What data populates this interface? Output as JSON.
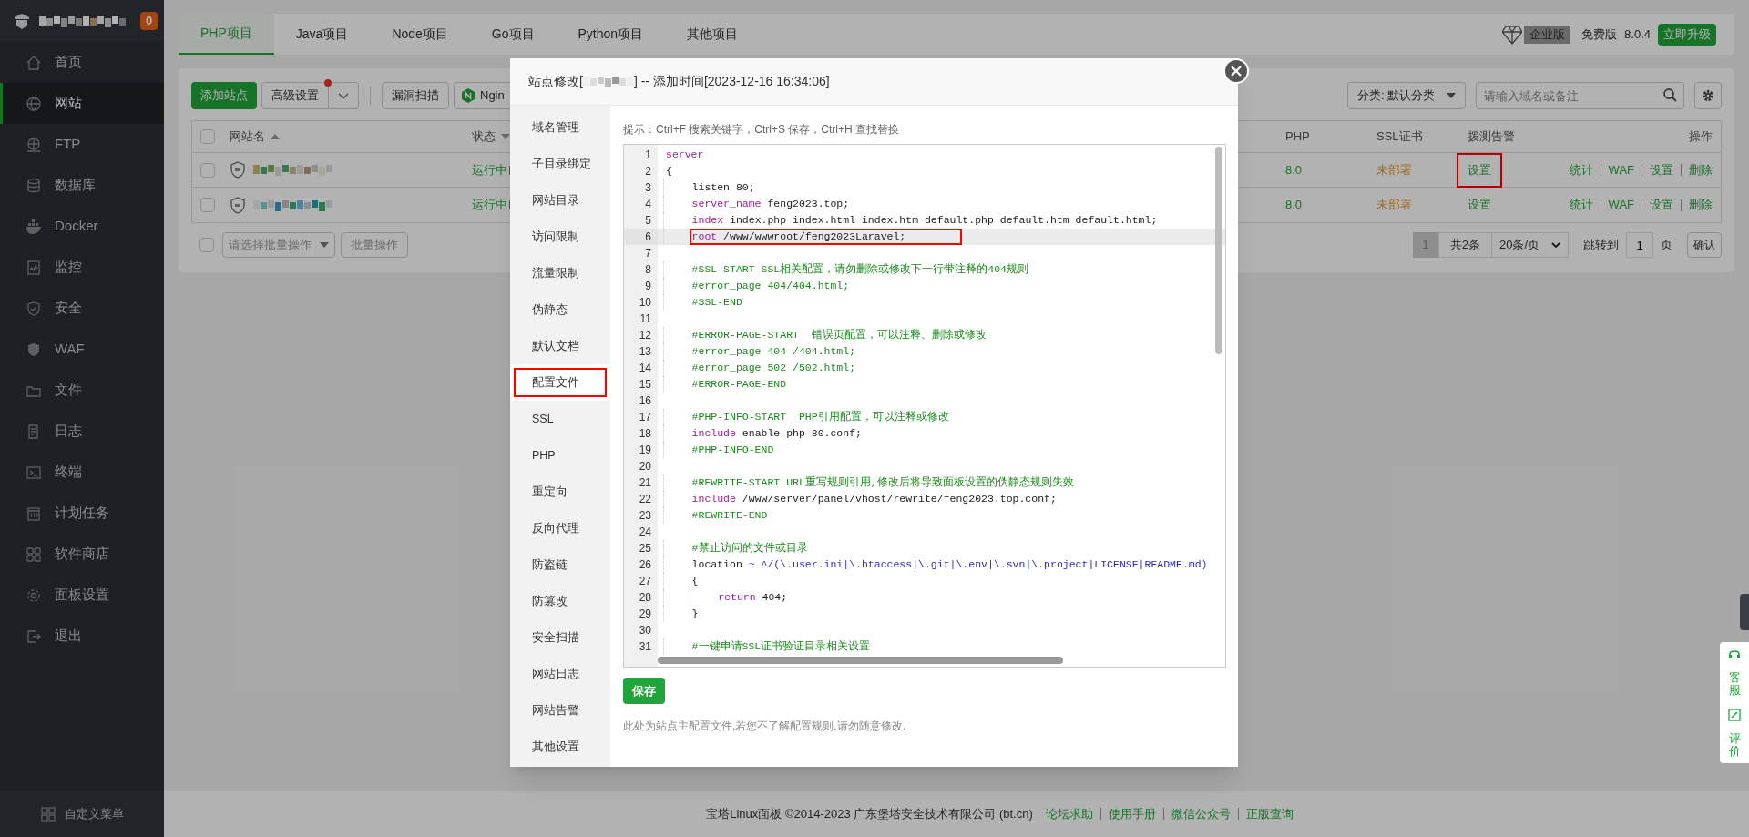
{
  "sidebar": {
    "badge": "0",
    "items": [
      {
        "label": "首页",
        "selected": false
      },
      {
        "label": "网站",
        "selected": true
      },
      {
        "label": "FTP",
        "selected": false
      },
      {
        "label": "数据库",
        "selected": false
      },
      {
        "label": "Docker",
        "selected": false
      },
      {
        "label": "监控",
        "selected": false
      },
      {
        "label": "安全",
        "selected": false
      },
      {
        "label": "WAF",
        "selected": false
      },
      {
        "label": "文件",
        "selected": false
      },
      {
        "label": "日志",
        "selected": false
      },
      {
        "label": "终端",
        "selected": false
      },
      {
        "label": "计划任务",
        "selected": false
      },
      {
        "label": "软件商店",
        "selected": false
      },
      {
        "label": "面板设置",
        "selected": false
      },
      {
        "label": "退出",
        "selected": false
      }
    ],
    "footer": "自定义菜单"
  },
  "top_tabs": [
    {
      "label": "PHP项目",
      "selected": true
    },
    {
      "label": "Java项目",
      "selected": false
    },
    {
      "label": "Node项目",
      "selected": false
    },
    {
      "label": "Go项目",
      "selected": false
    },
    {
      "label": "Python项目",
      "selected": false
    },
    {
      "label": "其他项目",
      "selected": false
    }
  ],
  "edition": {
    "badge": "企业版",
    "plan": "免费版",
    "version": "8.0.4",
    "upgrade": "立即升级"
  },
  "toolbar": {
    "add": "添加站点",
    "advanced": "高级设置",
    "advanced_dot": true,
    "scan": "漏洞扫描",
    "nginx": "Ngin",
    "category": "分类: 默认分类",
    "search_placeholder": "请输入域名或备注"
  },
  "table": {
    "all_checked": false,
    "columns": [
      "网站名",
      "状态",
      "PHP",
      "SSL证书",
      "拨测告警",
      "操作"
    ],
    "rows": [
      {
        "checked": false,
        "status": "运行中",
        "php": "8.0",
        "ssl": "未部署",
        "alert": "设置",
        "alert_annotated": true,
        "actions": [
          "统计",
          "WAF",
          "设置",
          "删除"
        ]
      },
      {
        "checked": false,
        "status": "运行中",
        "php": "8.0",
        "ssl": "未部署",
        "alert": "设置",
        "alert_annotated": false,
        "actions": [
          "统计",
          "WAF",
          "设置",
          "删除"
        ]
      }
    ]
  },
  "batch": {
    "checked": false,
    "placeholder": "请选择批量操作",
    "button": "批量操作"
  },
  "pagination": {
    "current": "1",
    "total": "共2条",
    "per_page": "20条/页",
    "goto": "跳转到",
    "page_input": "1",
    "page_unit": "页",
    "confirm": "确认"
  },
  "footer": {
    "copyright": "宝塔Linux面板 ©2014-2023 广东堡塔安全技术有限公司 (bt.cn)",
    "links": [
      "论坛求助",
      "使用手册",
      "微信公众号",
      "正版查询"
    ]
  },
  "side_widget": [
    "客服",
    "评价"
  ],
  "modal": {
    "title_prefix": "站点修改[",
    "title_suffix": "] -- 添加时间[2023-12-16 16:34:06]",
    "nav": [
      {
        "label": "域名管理",
        "selected": false,
        "annotated": false
      },
      {
        "label": "子目录绑定",
        "selected": false,
        "annotated": false
      },
      {
        "label": "网站目录",
        "selected": false,
        "annotated": false
      },
      {
        "label": "访问限制",
        "selected": false,
        "annotated": false
      },
      {
        "label": "流量限制",
        "selected": false,
        "annotated": false
      },
      {
        "label": "伪静态",
        "selected": false,
        "annotated": false
      },
      {
        "label": "默认文档",
        "selected": false,
        "annotated": false
      },
      {
        "label": "配置文件",
        "selected": true,
        "annotated": true
      },
      {
        "label": "SSL",
        "selected": false,
        "annotated": false
      },
      {
        "label": "PHP",
        "selected": false,
        "annotated": false
      },
      {
        "label": "重定向",
        "selected": false,
        "annotated": false
      },
      {
        "label": "反向代理",
        "selected": false,
        "annotated": false
      },
      {
        "label": "防盗链",
        "selected": false,
        "annotated": false
      },
      {
        "label": "防篡改",
        "selected": false,
        "annotated": false
      },
      {
        "label": "安全扫描",
        "selected": false,
        "annotated": false
      },
      {
        "label": "网站日志",
        "selected": false,
        "annotated": false
      },
      {
        "label": "网站告警",
        "selected": false,
        "annotated": false
      },
      {
        "label": "其他设置",
        "selected": false,
        "annotated": false
      }
    ],
    "hint": "提示：Ctrl+F 搜索关键字，Ctrl+S 保存，Ctrl+H 查找替换",
    "code": [
      {
        "number": "1",
        "active": false,
        "annotated": false,
        "tokens": [
          {
            "text": "server",
            "kind": "keyword"
          }
        ]
      },
      {
        "number": "2",
        "active": false,
        "annotated": false,
        "tokens": [
          {
            "text": "{",
            "kind": "plain"
          }
        ]
      },
      {
        "number": "3",
        "active": false,
        "annotated": false,
        "tokens": [
          {
            "text": "    listen 80;",
            "kind": "plain"
          }
        ]
      },
      {
        "number": "4",
        "active": false,
        "annotated": false,
        "tokens": [
          {
            "text": "    server_name",
            "kind": "keyword"
          },
          {
            "text": " feng2023.top;",
            "kind": "plain"
          }
        ]
      },
      {
        "number": "5",
        "active": false,
        "annotated": false,
        "tokens": [
          {
            "text": "    index",
            "kind": "keyword"
          },
          {
            "text": " index.php index.html index.htm default.php default.htm default.html;",
            "kind": "plain"
          }
        ]
      },
      {
        "number": "6",
        "active": true,
        "annotated": true,
        "tokens": [
          {
            "text": "    root",
            "kind": "keyword"
          },
          {
            "text": " /www/wwwroot/feng2023Laravel;",
            "kind": "plain"
          }
        ]
      },
      {
        "number": "7",
        "active": false,
        "annotated": false
      },
      {
        "number": "8",
        "active": false,
        "annotated": false,
        "tokens": [
          {
            "text": "    #SSL-START SSL相关配置，请勿删除或修改下一行带注释的404规则",
            "kind": "comment"
          }
        ]
      },
      {
        "number": "9",
        "active": false,
        "annotated": false,
        "tokens": [
          {
            "text": "    #error_page 404/404.html;",
            "kind": "comment"
          }
        ]
      },
      {
        "number": "10",
        "active": false,
        "annotated": false,
        "tokens": [
          {
            "text": "    #SSL-END",
            "kind": "comment"
          }
        ]
      },
      {
        "number": "11",
        "active": false,
        "annotated": false
      },
      {
        "number": "12",
        "active": false,
        "annotated": false,
        "tokens": [
          {
            "text": "    #ERROR-PAGE-START  错误页配置，可以注释、删除或修改",
            "kind": "comment"
          }
        ]
      },
      {
        "number": "13",
        "active": false,
        "annotated": false,
        "tokens": [
          {
            "text": "    #error_page 404 /404.html;",
            "kind": "comment"
          }
        ]
      },
      {
        "number": "14",
        "active": false,
        "annotated": false,
        "tokens": [
          {
            "text": "    #error_page 502 /502.html;",
            "kind": "comment"
          }
        ]
      },
      {
        "number": "15",
        "active": false,
        "annotated": false,
        "tokens": [
          {
            "text": "    #ERROR-PAGE-END",
            "kind": "comment"
          }
        ]
      },
      {
        "number": "16",
        "active": false,
        "annotated": false
      },
      {
        "number": "17",
        "active": false,
        "annotated": false,
        "tokens": [
          {
            "text": "    #PHP-INFO-START  PHP引用配置，可以注释或修改",
            "kind": "comment"
          }
        ]
      },
      {
        "number": "18",
        "active": false,
        "annotated": false,
        "tokens": [
          {
            "text": "    include",
            "kind": "keyword"
          },
          {
            "text": " enable-php-80.conf;",
            "kind": "plain"
          }
        ]
      },
      {
        "number": "19",
        "active": false,
        "annotated": false,
        "tokens": [
          {
            "text": "    #PHP-INFO-END",
            "kind": "comment"
          }
        ]
      },
      {
        "number": "20",
        "active": false,
        "annotated": false
      },
      {
        "number": "21",
        "active": false,
        "annotated": false,
        "tokens": [
          {
            "text": "    #REWRITE-START URL重写规则引用,修改后将导致面板设置的伪静态规则失效",
            "kind": "comment"
          }
        ]
      },
      {
        "number": "22",
        "active": false,
        "annotated": false,
        "tokens": [
          {
            "text": "    include",
            "kind": "keyword"
          },
          {
            "text": " /www/server/panel/vhost/rewrite/feng2023.top.conf;",
            "kind": "plain"
          }
        ]
      },
      {
        "number": "23",
        "active": false,
        "annotated": false,
        "tokens": [
          {
            "text": "    #REWRITE-END",
            "kind": "comment"
          }
        ]
      },
      {
        "number": "24",
        "active": false,
        "annotated": false
      },
      {
        "number": "25",
        "active": false,
        "annotated": false,
        "tokens": [
          {
            "text": "    #禁止访问的文件或目录",
            "kind": "comment"
          }
        ]
      },
      {
        "number": "26",
        "active": false,
        "annotated": false,
        "tokens": [
          {
            "text": "    location ",
            "kind": "plain"
          },
          {
            "text": "~ ^/(\\.user.ini|\\.htaccess|\\.git|\\.env|\\.svn|\\.project|LICENSE|README.md)",
            "kind": "regex"
          }
        ]
      },
      {
        "number": "27",
        "active": false,
        "annotated": false,
        "tokens": [
          {
            "text": "    {",
            "kind": "plain"
          }
        ]
      },
      {
        "number": "28",
        "active": false,
        "annotated": false,
        "tokens": [
          {
            "text": "        return",
            "kind": "keyword"
          },
          {
            "text": " 404;",
            "kind": "plain"
          }
        ]
      },
      {
        "number": "29",
        "active": false,
        "annotated": false,
        "tokens": [
          {
            "text": "    }",
            "kind": "plain"
          }
        ]
      },
      {
        "number": "30",
        "active": false,
        "annotated": false
      },
      {
        "number": "31",
        "active": false,
        "annotated": false,
        "tokens": [
          {
            "text": "    #一键申请SSL证书验证目录相关设置",
            "kind": "comment"
          }
        ]
      }
    ],
    "save": "保存",
    "note": "此处为站点主配置文件,若您不了解配置规则,请勿随意修改."
  }
}
